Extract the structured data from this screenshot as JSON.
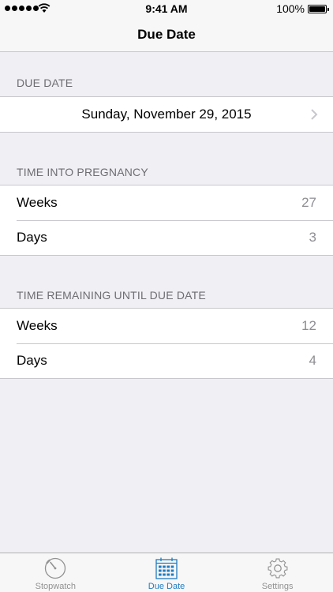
{
  "status_bar": {
    "time": "9:41 AM",
    "battery": "100%"
  },
  "nav": {
    "title": "Due Date"
  },
  "due_date": {
    "header": "DUE DATE",
    "value": "Sunday, November 29, 2015"
  },
  "time_into": {
    "header": "TIME INTO PREGNANCY",
    "rows": [
      {
        "label": "Weeks",
        "value": "27"
      },
      {
        "label": "Days",
        "value": "3"
      }
    ]
  },
  "time_remaining": {
    "header": "TIME REMAINING UNTIL DUE DATE",
    "rows": [
      {
        "label": "Weeks",
        "value": "12"
      },
      {
        "label": "Days",
        "value": "4"
      }
    ]
  },
  "tabs": [
    {
      "label": "Stopwatch",
      "icon": "stopwatch-icon"
    },
    {
      "label": "Due Date",
      "icon": "calendar-icon"
    },
    {
      "label": "Settings",
      "icon": "gear-icon"
    }
  ],
  "colors": {
    "accent": "#1e7cc2",
    "inactive": "#929292",
    "background": "#efeff4"
  }
}
